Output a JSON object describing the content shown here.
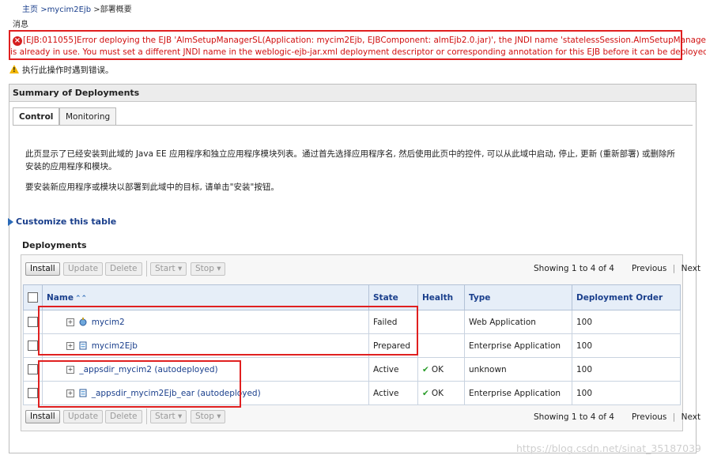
{
  "breadcrumb": [
    "主页",
    ">mycim2Ejb",
    ">部署概要"
  ],
  "messages_title": "消息",
  "error_line1": "[EJB:011055]Error deploying the EJB 'AlmSetupManagerSL(Application: mycim2Ejb, EJBComponent: almEjb2.0.jar)', the JNDI name 'statelessSession.AlmSetupManager'",
  "error_line2": "is already in use. You must set a different JNDI name in the weblogic-ejb-jar.xml deployment descriptor or corresponding annotation for this EJB before it can be deployed.",
  "warning": "执行此操作时遇到错误。",
  "panel_title": "Summary of Deployments",
  "tabs": [
    {
      "label": "Control"
    },
    {
      "label": "Monitoring"
    }
  ],
  "description": "此页显示了已经安装到此域的 Java EE 应用程序和独立应用程序模块列表。通过首先选择应用程序名, 然后使用此页中的控件, 可以从此域中启动, 停止, 更新 (重新部署) 或删除所安装的应用程序和模块。",
  "install_hint": "要安装新应用程序或模块以部署到此域中的目标, 请单击\"安装\"按钮。",
  "customize_link": "Customize this table",
  "deployments_title": "Deployments",
  "toolbar": {
    "install": "Install",
    "update": "Update",
    "delete": "Delete",
    "start": "Start",
    "stop": "Stop",
    "showing": "Showing 1 to 4 of 4",
    "previous": "Previous",
    "next": "Next"
  },
  "columns": [
    "Name",
    "State",
    "Health",
    "Type",
    "Deployment Order"
  ],
  "rows": [
    {
      "name": "mycim2",
      "state": "Failed",
      "health": "",
      "type": "Web Application",
      "order": "100"
    },
    {
      "name": "mycim2Ejb",
      "state": "Prepared",
      "health": "",
      "type": "Enterprise Application",
      "order": "100"
    },
    {
      "name": "_appsdir_mycim2 (autodeployed)",
      "state": "Active",
      "health": "OK",
      "type": "unknown",
      "order": "100"
    },
    {
      "name": "_appsdir_mycim2Ejb_ear (autodeployed)",
      "state": "Active",
      "health": "OK",
      "type": "Enterprise Application",
      "order": "100"
    }
  ],
  "watermark": "https://blog.csdn.net/sinat_35187039",
  "colors": {
    "error": "#d01010",
    "highlight": "#e02020",
    "link": "#1a3f8c",
    "header_bg": "#e6eef8",
    "ok": "#2a9d2a"
  }
}
